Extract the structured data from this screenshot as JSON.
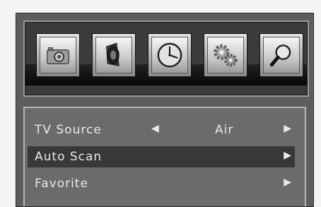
{
  "top_menu": {
    "icons": [
      {
        "name": "picture-menu-icon"
      },
      {
        "name": "sound-menu-icon"
      },
      {
        "name": "time-menu-icon"
      },
      {
        "name": "setup-menu-icon"
      },
      {
        "name": "channel-menu-icon"
      }
    ]
  },
  "settings": {
    "rows": [
      {
        "label": "TV Source",
        "value": "Air",
        "left_arrow": "◀",
        "right_arrow": "▶"
      },
      {
        "label": "Auto Scan",
        "right_arrow": "▶",
        "selected": true
      },
      {
        "label": "Favorite",
        "right_arrow": "▶"
      }
    ]
  }
}
